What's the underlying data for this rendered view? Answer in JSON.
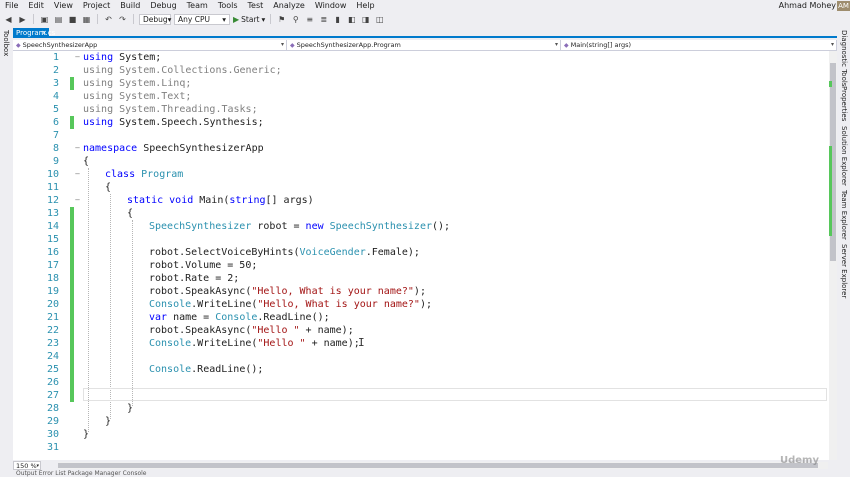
{
  "menu": [
    "File",
    "Edit",
    "View",
    "Project",
    "Build",
    "Debug",
    "Team",
    "Tools",
    "Test",
    "Analyze",
    "Window",
    "Help"
  ],
  "user": {
    "name": "Ahmad Mohey",
    "initials": "AM"
  },
  "toolbar": {
    "config": "Debug",
    "platform": "Any CPU",
    "start_label": "Start"
  },
  "left_panel": {
    "toolbox": "Toolbox"
  },
  "right_panels": [
    "Diagnostic Tools",
    "Properties",
    "Solution Explorer",
    "Team Explorer",
    "Server Explorer"
  ],
  "tab": {
    "label": "Program.cs"
  },
  "navbar": {
    "project": "SpeechSynthesizerApp",
    "class": "SpeechSynthesizerApp.Program",
    "member": "Main(string[] args)"
  },
  "line_numbers": [
    "1",
    "2",
    "3",
    "4",
    "5",
    "6",
    "7",
    "8",
    "9",
    "10",
    "11",
    "12",
    "13",
    "14",
    "15",
    "16",
    "17",
    "18",
    "19",
    "20",
    "21",
    "22",
    "23",
    "24",
    "25",
    "26",
    "27",
    "28",
    "29",
    "30",
    "31"
  ],
  "code": {
    "l1_kw": "using",
    "l1_rest": " System;",
    "l2": "using System.Collections.Generic;",
    "l3": "using System.Linq;",
    "l4": "using System.Text;",
    "l5": "using System.Threading.Tasks;",
    "l6_kw": "using",
    "l6_rest": " System.Speech.Synthesis;",
    "l8_kw": "namespace",
    "l8_rest": " SpeechSynthesizerApp",
    "l9": "{",
    "l10_kw": "class",
    "l10_ty": "Program",
    "l11": "{",
    "l12_kw1": "static",
    "l12_kw2": "void",
    "l12_a": " Main(",
    "l12_kw3": "string",
    "l12_b": "[] args)",
    "l13": "{",
    "l14_ty1": "SpeechSynthesizer",
    "l14_a": " robot = ",
    "l14_kw": "new",
    "l14_ty2": "SpeechSynthesizer",
    "l14_b": "();",
    "l16_a": "robot.SelectVoiceByHints(",
    "l16_ty": "VoiceGender",
    "l16_b": ".Female);",
    "l17": "robot.Volume = 50;",
    "l18": "robot.Rate = 2;",
    "l19_a": "robot.SpeakAsync(",
    "l19_st": "\"Hello, What is your name?\"",
    "l19_b": ");",
    "l20_ty": "Console",
    "l20_a": ".WriteLine(",
    "l20_st": "\"Hello, What is your name?\"",
    "l20_b": ");",
    "l21_kw": "var",
    "l21_a": " name = ",
    "l21_ty": "Console",
    "l21_b": ".ReadLine();",
    "l22_a": "robot.SpeakAsync(",
    "l22_st": "\"Hello \"",
    "l22_b": " + name);",
    "l23_ty": "Console",
    "l23_a": ".WriteLine(",
    "l23_st": "\"Hello \"",
    "l23_b": " + name);",
    "l25_ty": "Console",
    "l25_a": ".ReadLine();",
    "l28": "}",
    "l29": "}",
    "l30": "}"
  },
  "status": {
    "zoom": "150 %"
  },
  "bottom_tabs": "Output   Error List   Package Manager Console",
  "watermark": "Udemy",
  "colors": {
    "accent": "#007acc",
    "keyword": "#0000ff",
    "type": "#2b91af",
    "string": "#a31515",
    "changed": "#57c75b"
  }
}
